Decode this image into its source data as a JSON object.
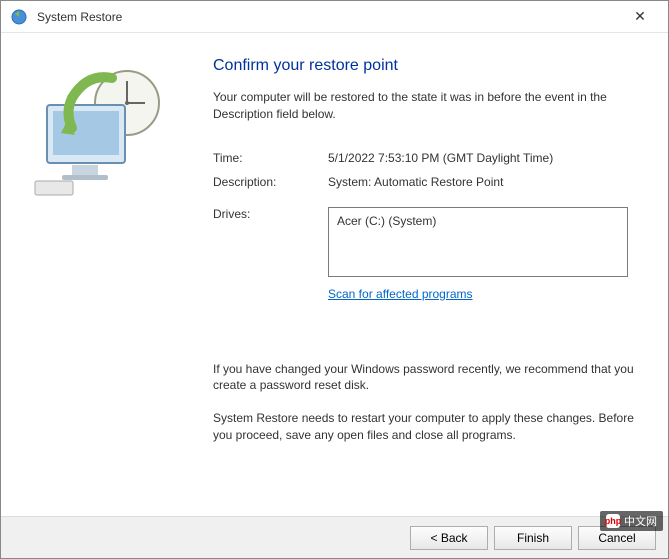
{
  "window": {
    "title": "System Restore",
    "close": "✕"
  },
  "heading": "Confirm your restore point",
  "description": "Your computer will be restored to the state it was in before the event in the Description field below.",
  "fields": {
    "time_label": "Time:",
    "time_value": "5/1/2022 7:53:10 PM (GMT Daylight Time)",
    "desc_label": "Description:",
    "desc_value": "System: Automatic Restore Point",
    "drives_label": "Drives:",
    "drives_value": "Acer (C:) (System)"
  },
  "scan_link": "Scan for affected programs",
  "note1": "If you have changed your Windows password recently, we recommend that you create a password reset disk.",
  "note2": "System Restore needs to restart your computer to apply these changes. Before you proceed, save any open files and close all programs.",
  "buttons": {
    "back": "< Back",
    "finish": "Finish",
    "cancel": "Cancel"
  },
  "watermark": "中文网"
}
